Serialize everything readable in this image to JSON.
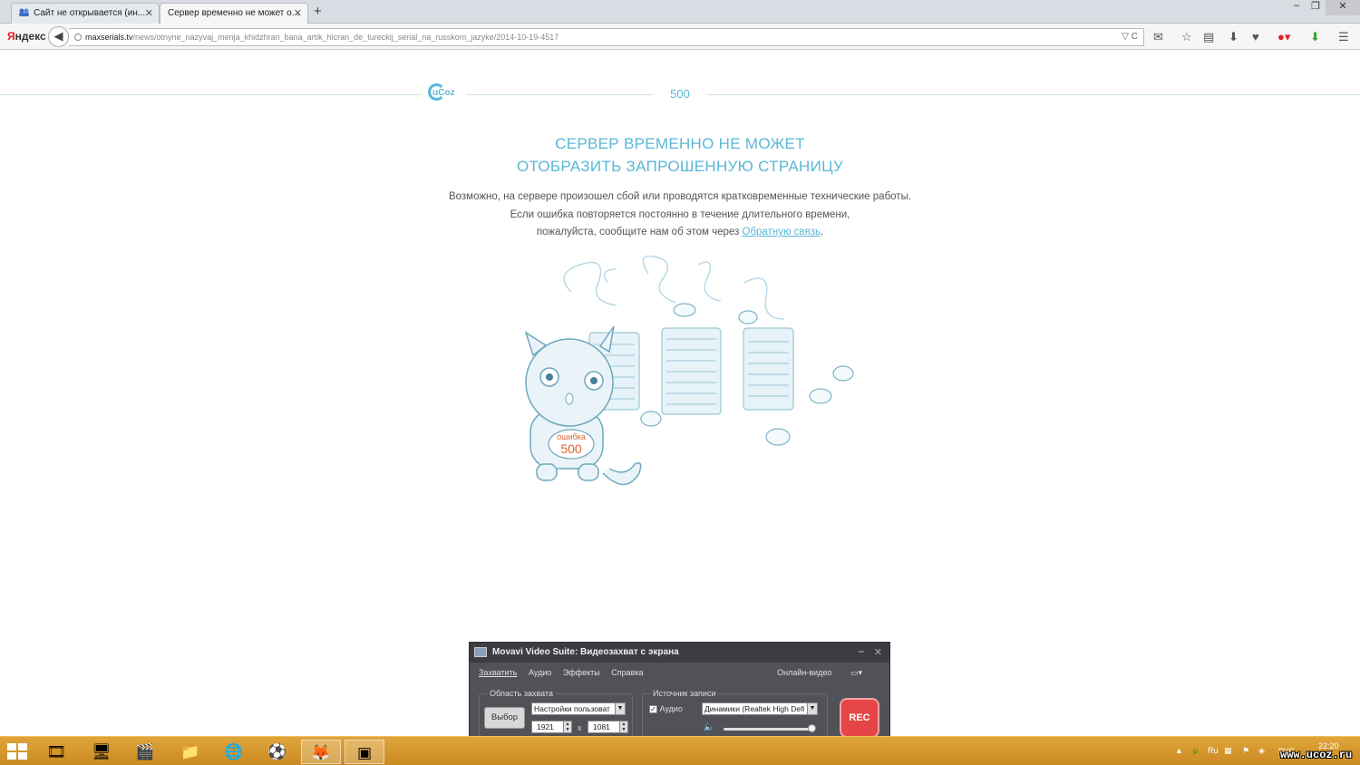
{
  "browser": {
    "tabs": [
      {
        "label": "Сайт не открывается (ин..."
      },
      {
        "label": "Сервер временно не может о..."
      }
    ],
    "new_tab": "+",
    "window_controls": {
      "minimize": "–",
      "restore": "❐",
      "close": "✕"
    },
    "logo": {
      "first": "Я",
      "rest": "ндекс"
    },
    "back": "◀",
    "url_host": "maxserials.tv",
    "url_path": "/news/otnyne_nazyvaj_menja_khidzhran_bana_artik_hicran_de_tureckij_serial_na_russkom_jazyke/2014-10-19-4517",
    "url_tools": "▽ C",
    "toolbar_icons": [
      "mail-icon",
      "star-icon",
      "clipboard-icon",
      "download-icon",
      "extension-icon",
      "adblock-icon",
      "save-icon",
      "menu-icon"
    ]
  },
  "page": {
    "logo_text": "uCoz",
    "error_code": "500",
    "title_line1": "СЕРВЕР ВРЕМЕННО НЕ МОЖЕТ",
    "title_line2": "ОТОБРАЗИТЬ ЗАПРОШЕННУЮ СТРАНИЦУ",
    "desc_line1": "Возможно, на сервере произошел сбой или проводятся кратковременные технические работы.",
    "desc_line2": "Если ошибка повторяется постоянно в течение длительного времени,",
    "desc_line3_prefix": "пожалуйста, сообщите нам об этом через ",
    "desc_link": "Обратную связь",
    "desc_line3_suffix": ".",
    "shirt_label": "ошибка",
    "shirt_code": "500",
    "accent": "#5ab7d6"
  },
  "movavi": {
    "title": "Movavi Video Suite: Видеозахват с экрана",
    "win_minimize": "–",
    "win_close": "✕",
    "menu": {
      "capture": "Захватить",
      "audio": "Аудио",
      "effects": "Эффекты",
      "help": "Справка",
      "online": "Онлайн-видео"
    },
    "area_label": "Область захвата",
    "select_button": "Выбор",
    "preset": "Настройки пользоват",
    "width": "1921",
    "height": "1081",
    "times": "x",
    "source_label": "Источник записи",
    "audio_checkbox": "Аудио",
    "audio_device": "Динамики (Realtek High Defi",
    "rec": "REC",
    "volume_level": 0.95
  },
  "taskbar": {
    "apps": [
      "media-player-icon",
      "monitor-icon",
      "film-icon",
      "folder-icon",
      "globe-icon",
      "football-icon",
      "firefox-icon",
      "movavi-icon"
    ],
    "tray_lang": "РУС",
    "time": "22:20"
  },
  "watermark": "www.ucoz.ru"
}
